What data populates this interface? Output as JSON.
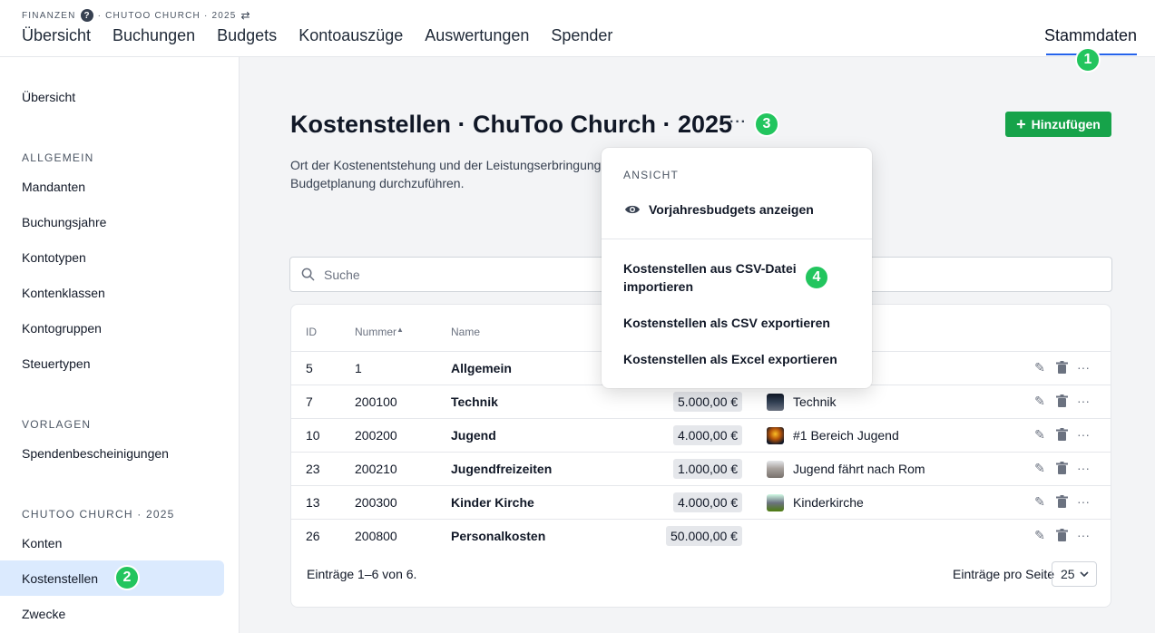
{
  "header": {
    "breadcrumb_section": "FINANZEN",
    "breadcrumb_context": "· CHUTOO CHURCH · 2025",
    "help_icon": "?",
    "nav": [
      "Übersicht",
      "Buchungen",
      "Budgets",
      "Kontoauszüge",
      "Auswertungen",
      "Spender"
    ],
    "nav_right": "Stammdaten"
  },
  "badges": [
    "1",
    "2",
    "3",
    "4"
  ],
  "sidebar": {
    "top_item": "Übersicht",
    "group1_title": "ALLGEMEIN",
    "group1_items": [
      "Mandanten",
      "Buchungsjahre",
      "Kontotypen",
      "Kontenklassen",
      "Kontogruppen",
      "Steuertypen"
    ],
    "group2_title": "VORLAGEN",
    "group2_items": [
      "Spendenbescheinigungen"
    ],
    "group3_title": "CHUTOO CHURCH · 2025",
    "group3_items": [
      "Konten",
      "Kostenstellen",
      "Zwecke"
    ]
  },
  "main": {
    "title": "Kostenstellen · ChuToo Church · 2025",
    "title_menu": "···",
    "description_line1": "Ort der Kostenentstehung und der Leistungserbringung.",
    "description_line2": "Budgetplanung durchzuführen.",
    "add_button": "Hinzufügen",
    "search_placeholder": "Suche"
  },
  "table": {
    "columns": {
      "id": "ID",
      "number": "Nummer",
      "name": "Name"
    },
    "rows": [
      {
        "id": "5",
        "number": "1",
        "name": "Allgemein",
        "amount": "",
        "purpose": ""
      },
      {
        "id": "7",
        "number": "200100",
        "name": "Technik",
        "amount": "5.000,00 €",
        "purpose": "Technik"
      },
      {
        "id": "10",
        "number": "200200",
        "name": "Jugend",
        "amount": "4.000,00 €",
        "purpose": "#1 Bereich Jugend"
      },
      {
        "id": "23",
        "number": "200210",
        "name": "Jugendfreizeiten",
        "amount": "1.000,00 €",
        "purpose": "Jugend fährt nach Rom"
      },
      {
        "id": "13",
        "number": "200300",
        "name": "Kinder Kirche",
        "amount": "4.000,00 €",
        "purpose": "Kinderkirche"
      },
      {
        "id": "26",
        "number": "200800",
        "name": "Personalkosten",
        "amount": "50.000,00 €",
        "purpose": ""
      }
    ],
    "footer_count": "Einträge 1–6 von 6.",
    "footer_per_page_label": "Einträge pro Seite",
    "per_page_value": "25"
  },
  "dropdown": {
    "section_title": "ANSICHT",
    "toggle_item": "Vorjahresbudgets anzeigen",
    "import_line1": "Kostenstellen aus CSV-Datei",
    "import_line2": "importieren",
    "export_csv": "Kostenstellen als CSV exportieren",
    "export_excel": "Kostenstellen als Excel exportieren"
  },
  "colors": {
    "accent": "#2563eb",
    "add_button": "#16a34a",
    "badge": "#22c55e",
    "active_sidebar": "#dbeafe"
  }
}
